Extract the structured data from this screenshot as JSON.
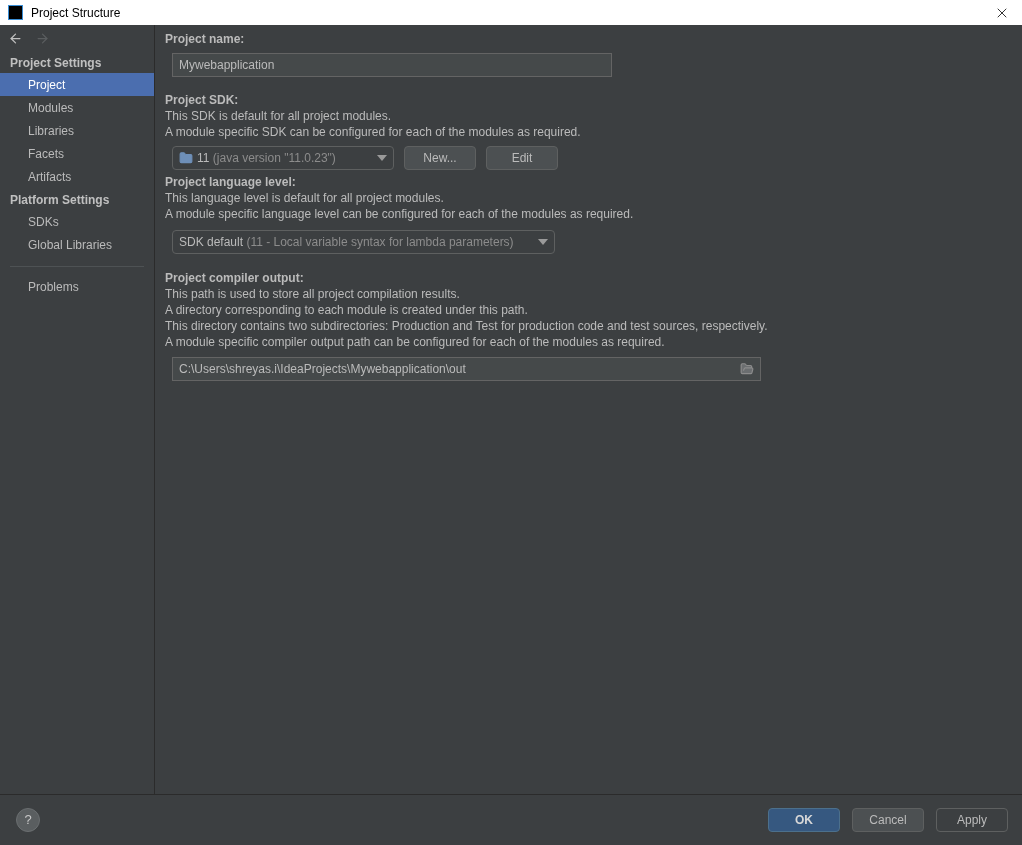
{
  "window": {
    "title": "Project Structure"
  },
  "nav": {
    "back_enabled": true,
    "forward_enabled": false
  },
  "sidebar": {
    "sections": [
      {
        "title": "Project Settings",
        "items": [
          {
            "label": "Project",
            "selected": true
          },
          {
            "label": "Modules",
            "selected": false
          },
          {
            "label": "Libraries",
            "selected": false
          },
          {
            "label": "Facets",
            "selected": false
          },
          {
            "label": "Artifacts",
            "selected": false
          }
        ]
      },
      {
        "title": "Platform Settings",
        "items": [
          {
            "label": "SDKs",
            "selected": false
          },
          {
            "label": "Global Libraries",
            "selected": false
          }
        ]
      }
    ],
    "footer_items": [
      {
        "label": "Problems",
        "selected": false
      }
    ]
  },
  "project_name": {
    "label": "Project name:",
    "value": "Mywebapplication"
  },
  "project_sdk": {
    "label": "Project SDK:",
    "lines": [
      "This SDK is default for all project modules.",
      "A module specific SDK can be configured for each of the modules as required."
    ],
    "value": "11",
    "detail": "(java version \"11.0.23\")",
    "buttons": [
      "New...",
      "Edit"
    ]
  },
  "language_level": {
    "label": "Project language level:",
    "lines": [
      "This language level is default for all project modules.",
      "A module specific language level can be configured for each of the modules as required."
    ],
    "value": "SDK default",
    "detail": "(11 - Local variable syntax for lambda parameters)"
  },
  "compiler_output": {
    "label": "Project compiler output:",
    "lines": [
      "This path is used to store all project compilation results.",
      "A directory corresponding to each module is created under this path.",
      "This directory contains two subdirectories: Production and Test for production code and test sources, respectively.",
      "A module specific compiler output path can be configured for each of the modules as required."
    ],
    "value": "C:\\Users\\shreyas.i\\IdeaProjects\\Mywebapplication\\out"
  },
  "help": "?",
  "buttons": [
    {
      "label": "OK",
      "primary": true,
      "disabled": false
    },
    {
      "label": "Cancel",
      "primary": false,
      "disabled": false
    },
    {
      "label": "Apply",
      "primary": false,
      "disabled": true
    }
  ]
}
